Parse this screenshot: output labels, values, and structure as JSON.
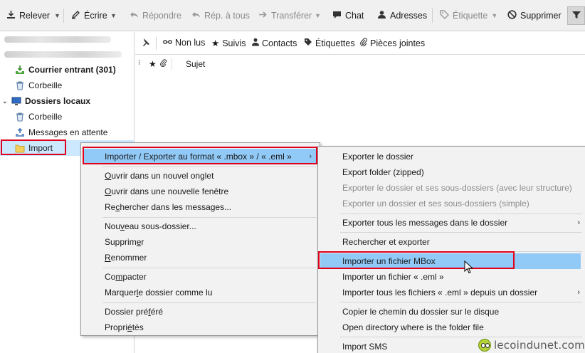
{
  "toolbar": {
    "get_mail": "Relever",
    "write": "Écrire",
    "reply": "Répondre",
    "reply_all": "Rép. à tous",
    "forward": "Transférer",
    "chat": "Chat",
    "address_book": "Adresses",
    "tag": "Étiquette",
    "delete": "Supprimer"
  },
  "folders": {
    "inbox": "Courrier entrant (301)",
    "account_trash": "Corbeille",
    "local_folders": "Dossiers locaux",
    "local_trash": "Corbeille",
    "outbox": "Messages en attente",
    "import": "Import"
  },
  "quick_filter": {
    "unread": "Non lus",
    "starred": "Suivis",
    "contacts": "Contacts",
    "tags": "Étiquettes",
    "attachments": "Pièces jointes"
  },
  "columns": {
    "subject": "Sujet"
  },
  "context_menu": {
    "items": [
      {
        "pre": "Importer / Exporter au format « .mbox » / « .eml »",
        "u": "",
        "post": ""
      },
      {
        "pre": "",
        "u": "O",
        "post": "uvrir dans un nouvel onglet"
      },
      {
        "pre": "",
        "u": "O",
        "post": "uvrir dans une nouvelle fenêtre"
      },
      {
        "pre": "Re",
        "u": "c",
        "post": "hercher dans les messages..."
      },
      {
        "pre": "Nou",
        "u": "v",
        "post": "eau sous-dossier..."
      },
      {
        "pre": "Supprim",
        "u": "e",
        "post": "r"
      },
      {
        "pre": "",
        "u": "R",
        "post": "enommer"
      },
      {
        "pre": "Co",
        "u": "m",
        "post": "pacter"
      },
      {
        "pre": "Marquer ",
        "u": "l",
        "post": "e dossier comme lu"
      },
      {
        "pre": "Dossier pré",
        "u": "f",
        "post": "éré"
      },
      {
        "pre": "Propri",
        "u": "é",
        "post": "tés"
      }
    ]
  },
  "submenu": {
    "export_folder": "Exporter le dossier",
    "export_zipped": "Export folder (zipped)",
    "export_with_subfolders_structure": "Exporter le dossier et ses sous-dossiers (avec leur structure)",
    "export_with_subfolders_simple": "Exporter un dossier et ses sous-dossiers (simple)",
    "export_all_messages": "Exporter tous les messages dans le dossier",
    "search_export": "Rechercher et exporter",
    "import_mbox": "Importer un fichier MBox",
    "import_eml": "Importer un fichier « .eml »",
    "import_all_eml": "Importer tous les fichiers « .eml » depuis un dossier",
    "copy_path": "Copier le chemin du dossier sur le disque",
    "open_directory": "Open directory where is the folder file",
    "import_sms": "Import SMS"
  },
  "watermark": "lecoindunet.com",
  "colors": {
    "highlight_red": "#e0001b",
    "menu_hover": "#91c9f7",
    "selection": "#cce8ff"
  }
}
